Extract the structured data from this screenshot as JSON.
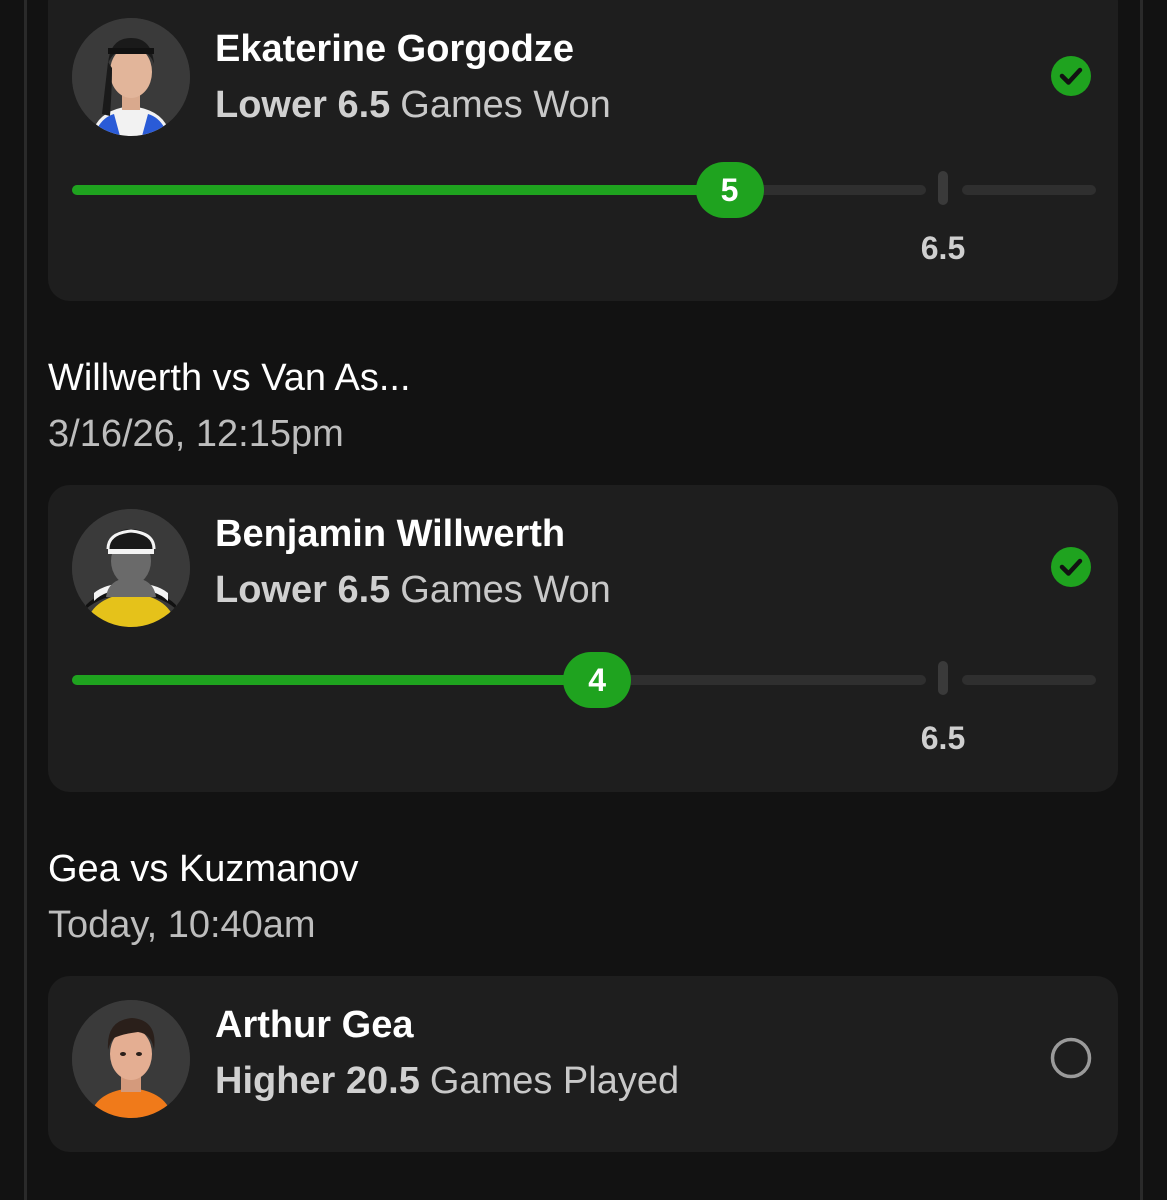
{
  "colors": {
    "background": "#121212",
    "card": "#1e1e1e",
    "progress_green": "#1fa31f",
    "track": "#2f2f2f"
  },
  "picks": [
    {
      "player_name": "Ekaterine Gorgodze",
      "direction": "Lower 6.5",
      "stat": "Games Won",
      "current_value": "5",
      "line_value": "6.5",
      "progress_fraction": 0.77,
      "status_icon": "check-circle-icon"
    },
    {
      "match_title": "Willwerth vs Van As...",
      "match_time": "3/16/26, 12:15pm",
      "player_name": "Benjamin Willwerth",
      "direction": "Lower 6.5",
      "stat": "Games Won",
      "current_value": "4",
      "line_value": "6.5",
      "progress_fraction": 0.615,
      "status_icon": "check-circle-icon"
    },
    {
      "match_title": "Gea vs Kuzmanov",
      "match_time": "Today, 10:40am",
      "player_name": "Arthur Gea",
      "direction": "Higher 20.5",
      "stat": "Games Played",
      "status_icon": "empty-circle-icon"
    }
  ]
}
